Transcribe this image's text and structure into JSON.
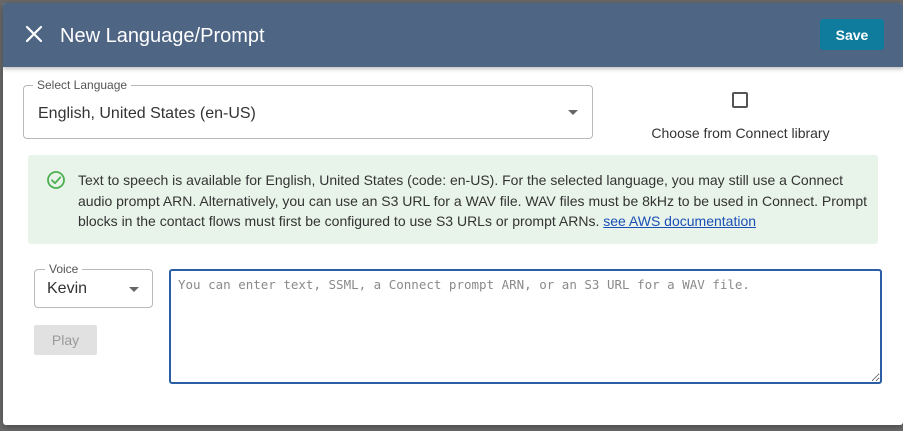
{
  "header": {
    "title": "New Language/Prompt",
    "save_label": "Save",
    "close_icon": "close-icon",
    "background": "#4e6584",
    "save_color": "#0f7c9e"
  },
  "language": {
    "label": "Select Language",
    "value": "English, United States (en-US)"
  },
  "library": {
    "checked": false,
    "label": "Choose from Connect library"
  },
  "info": {
    "icon": "check-circle-icon",
    "text": "Text to speech is available for English, United States (code: en-US). For the selected language, you may still use a Connect audio prompt ARN. Alternatively, you can use an S3 URL for a WAV file. WAV files must be 8kHz to be used in Connect. Prompt blocks in the contact flows must first be configured to use S3 URLs or prompt ARNs.",
    "link_text": "see AWS documentation",
    "background": "#e8f4ea",
    "icon_color": "#4caf50"
  },
  "voice": {
    "label": "Voice",
    "value": "Kevin",
    "play_label": "Play"
  },
  "prompt": {
    "placeholder": "You can enter text, SSML, a Connect prompt ARN, or an S3 URL for a WAV file.",
    "value": ""
  }
}
